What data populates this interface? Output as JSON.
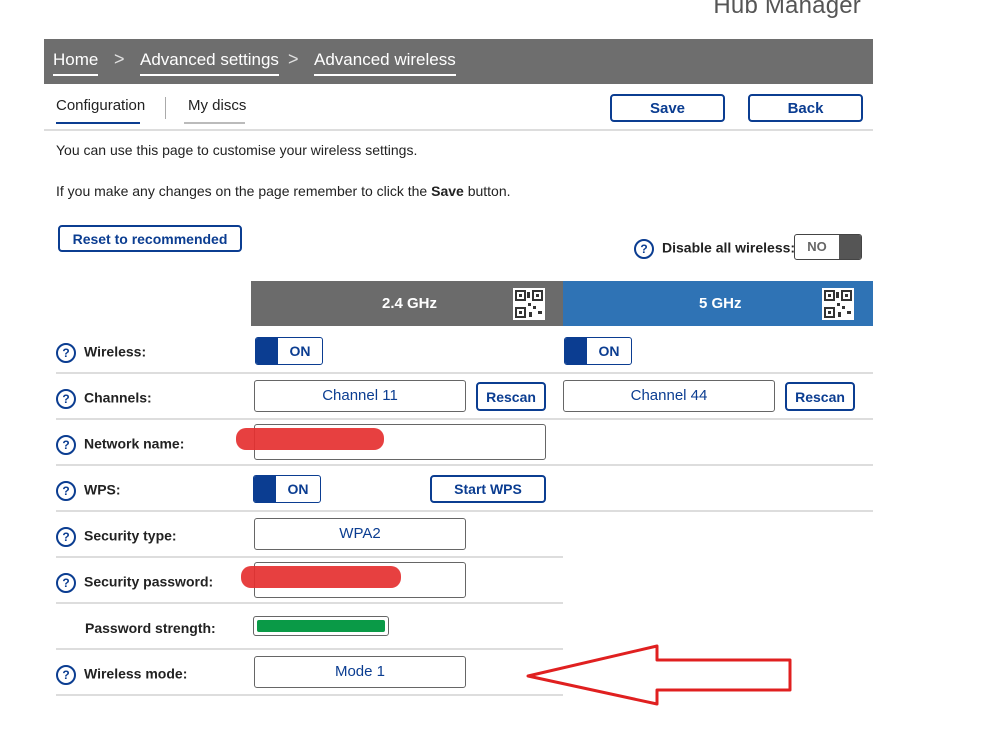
{
  "app_title": "Hub Manager",
  "breadcrumb": {
    "items": [
      "Home",
      "Advanced settings",
      "Advanced wireless"
    ],
    "separator": ">"
  },
  "subtabs": {
    "configuration": "Configuration",
    "my_discs": "My discs"
  },
  "buttons": {
    "save": "Save",
    "back": "Back",
    "reset": "Reset to recommended",
    "rescan": "Rescan",
    "start_wps": "Start WPS"
  },
  "intro": {
    "line1": "You can use this page to customise your wireless settings.",
    "line2_pre": "If you make any changes on the page remember to click the ",
    "line2_bold": "Save",
    "line2_post": " button."
  },
  "disable_all": {
    "label": "Disable all wireless:",
    "value": "NO"
  },
  "help_glyph": "?",
  "columns": {
    "band_24": "2.4 GHz",
    "band_5": "5 GHz"
  },
  "rows": {
    "wireless": {
      "label": "Wireless:",
      "value_24": "ON",
      "value_5": "ON"
    },
    "channels": {
      "label": "Channels:",
      "value_24": "Channel 11",
      "value_5": "Channel 44"
    },
    "network_name": {
      "label": "Network name:"
    },
    "wps": {
      "label": "WPS:",
      "value": "ON"
    },
    "security_type": {
      "label": "Security type:",
      "value": "WPA2"
    },
    "security_password": {
      "label": "Security password:"
    },
    "password_strength": {
      "label": "Password strength:",
      "strength": 1.0
    },
    "wireless_mode": {
      "label": "Wireless mode:",
      "value": "Mode 1"
    }
  },
  "colors": {
    "brand_blue": "#0b3d91",
    "header_grey": "#6e6e6e",
    "header_24": "#6b6b6b",
    "header_5": "#2f73b5",
    "strength_green": "#0a9a47",
    "annotation_red": "#e02020"
  },
  "icons": {
    "qr": "qr-code-icon",
    "help": "help-icon",
    "chevron": "chevron-right-icon"
  }
}
